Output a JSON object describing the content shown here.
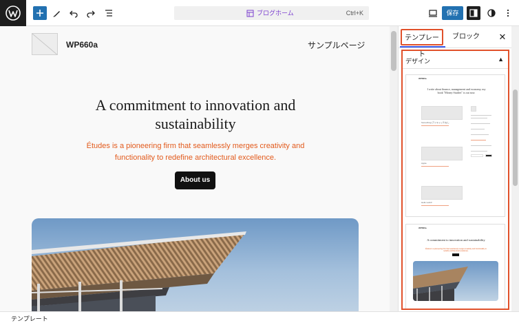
{
  "toolbar": {
    "command_title": "ブログホーム",
    "command_shortcut": "Ctrl+K",
    "save_label": "保存"
  },
  "canvas": {
    "site_title": "WP660a",
    "nav_link": "サンプルページ",
    "hero_heading": "A commitment to innovation and sustainability",
    "hero_subheading": "Études is a pioneering firm that seamlessly merges creativity and functionality to redefine architectural excellence.",
    "about_button": "About us"
  },
  "sidebar": {
    "tab_template": "テンプレート",
    "tab_block": "ブロック",
    "design_title": "デザイン",
    "preview1": {
      "heading": "I write about finance, management and economy, my book \"Money Studies\" is out now.",
      "post1": "Something [アイキャッチ]なし",
      "post2": "Apple",
      "post3": "Hello world!"
    },
    "preview2": {
      "heading": "A commitment to innovation and sustainability",
      "sub": "Études is a pioneering firm that seamlessly merges creativity and functionality to redefine architectural excellence."
    }
  },
  "footer": {
    "breadcrumb": "テンプレート"
  },
  "colors": {
    "accent": "#2271b1",
    "highlight": "#e0502a",
    "hero_sub": "#e25a1c",
    "command_title": "#7b3fd0"
  }
}
